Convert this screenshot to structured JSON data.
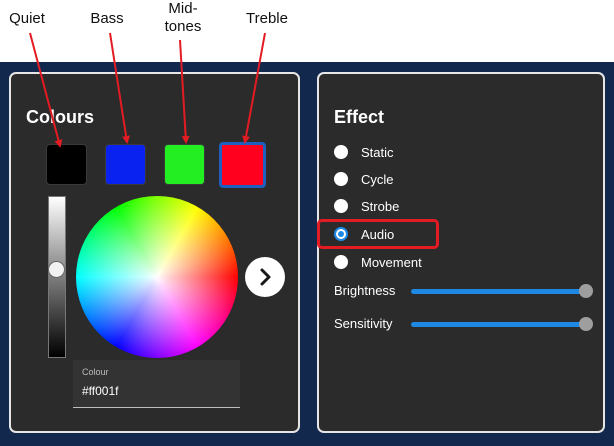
{
  "annotations": [
    {
      "id": "quiet",
      "text": "Quiet"
    },
    {
      "id": "bass",
      "text": "Bass"
    },
    {
      "id": "midtones",
      "text": "Mid-\ntones"
    },
    {
      "id": "treble",
      "text": "Treble"
    }
  ],
  "colours_panel": {
    "title": "Colours",
    "swatches": [
      {
        "name": "quiet",
        "color": "#000000"
      },
      {
        "name": "bass",
        "color": "#0a22f0"
      },
      {
        "name": "midtones",
        "color": "#22ee22"
      },
      {
        "name": "treble",
        "color": "#ff001f",
        "selected": true
      }
    ],
    "brightness_level": 0.45,
    "colour_field": {
      "label": "Colour",
      "value": "#ff001f"
    }
  },
  "effect_panel": {
    "title": "Effect",
    "options": [
      {
        "label": "Static",
        "checked": false
      },
      {
        "label": "Cycle",
        "checked": false
      },
      {
        "label": "Strobe",
        "checked": false
      },
      {
        "label": "Audio",
        "checked": true
      },
      {
        "label": "Movement",
        "checked": false
      }
    ],
    "sliders": [
      {
        "label": "Brightness",
        "value": 1.0
      },
      {
        "label": "Sensitivity",
        "value": 1.0
      }
    ]
  },
  "colors": {
    "background": "#12294d",
    "panel": "#2b2b2b",
    "accent": "#1e88e5",
    "highlight": "#e31b23"
  }
}
